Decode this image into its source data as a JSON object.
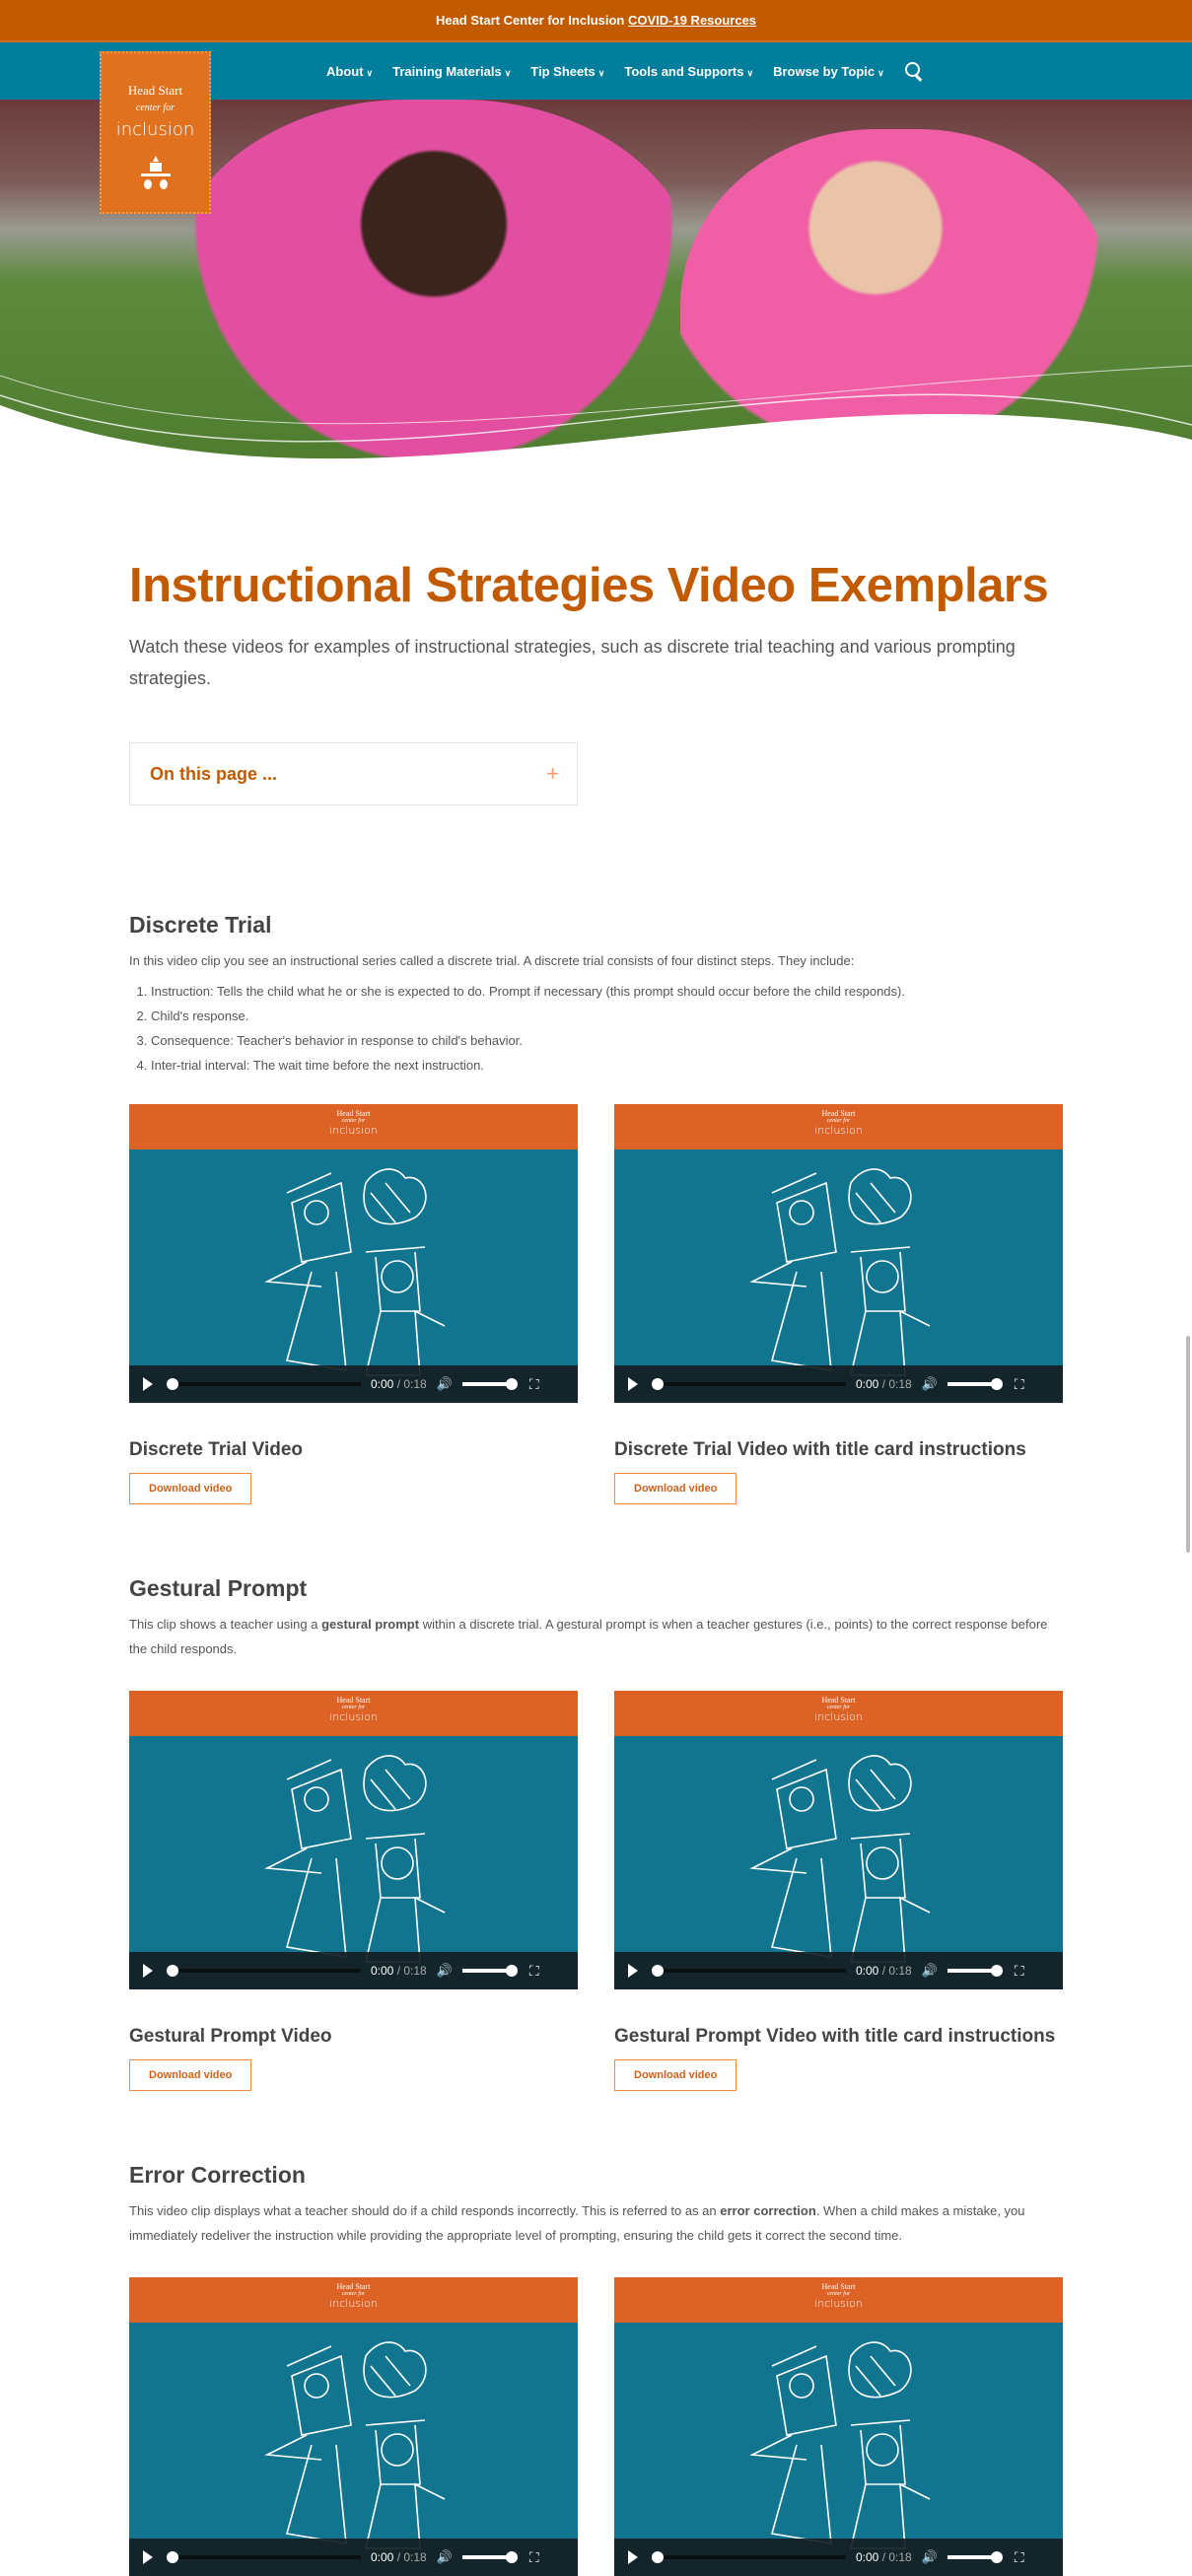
{
  "topbar": {
    "text": "Head Start Center for Inclusion",
    "link": "COVID-19 Resources"
  },
  "logo": {
    "line1": "Head Start",
    "line2": "center for",
    "line3": "inclusion"
  },
  "nav": [
    {
      "label": "About"
    },
    {
      "label": "Training Materials"
    },
    {
      "label": "Tip Sheets"
    },
    {
      "label": "Tools and Supports"
    },
    {
      "label": "Browse by Topic"
    }
  ],
  "page": {
    "title": "Instructional Strategies Video Exemplars",
    "intro": "Watch these videos for examples of instructional strategies, such as discrete trial teaching and various prompting strategies.",
    "toc_label": "On this page ...",
    "toc_icon": "plus-icon"
  },
  "player": {
    "band1": "Head Start",
    "band2": "center for",
    "band3": "inclusion",
    "current": "0:00",
    "duration": "/ 0:18"
  },
  "download_label": "Download video",
  "sections": [
    {
      "heading": "Discrete Trial",
      "paragraph": [
        {
          "t": "In this video clip you see an instructional series called a discrete trial. A discrete trial consists of four distinct steps. They include:"
        }
      ],
      "list": [
        "Instruction: Tells the child what he or she is expected to do. Prompt if necessary (this prompt should occur before the child responds).",
        "Child's response.",
        "Consequence: Teacher's behavior in response to child's behavior.",
        "Inter-trial interval: The wait time before the next instruction."
      ],
      "videos": [
        "Discrete Trial Video",
        "Discrete Trial Video with title card instructions"
      ]
    },
    {
      "heading": "Gestural Prompt",
      "paragraph": [
        {
          "t": "This clip shows a teacher using a "
        },
        {
          "t": "gestural prompt",
          "b": true
        },
        {
          "t": " within a discrete trial. A gestural prompt is when a teacher gestures (i.e., points) to the correct response before the child responds."
        }
      ],
      "list": [],
      "videos": [
        "Gestural Prompt Video",
        "Gestural Prompt Video with title card instructions"
      ]
    },
    {
      "heading": "Error Correction",
      "paragraph": [
        {
          "t": "This video clip displays what a teacher should do if a child responds incorrectly. This is referred to as an "
        },
        {
          "t": "error correction",
          "b": true
        },
        {
          "t": ". When a child makes a mistake, you immediately redeliver the instruction while providing the appropriate level of prompting, ensuring the child gets it correct the second time."
        }
      ],
      "list": [],
      "videos": [
        "",
        ""
      ]
    }
  ],
  "colors": {
    "brand_orange": "#c25a00",
    "nav_teal": "#017e9b",
    "video_teal": "#127590"
  }
}
